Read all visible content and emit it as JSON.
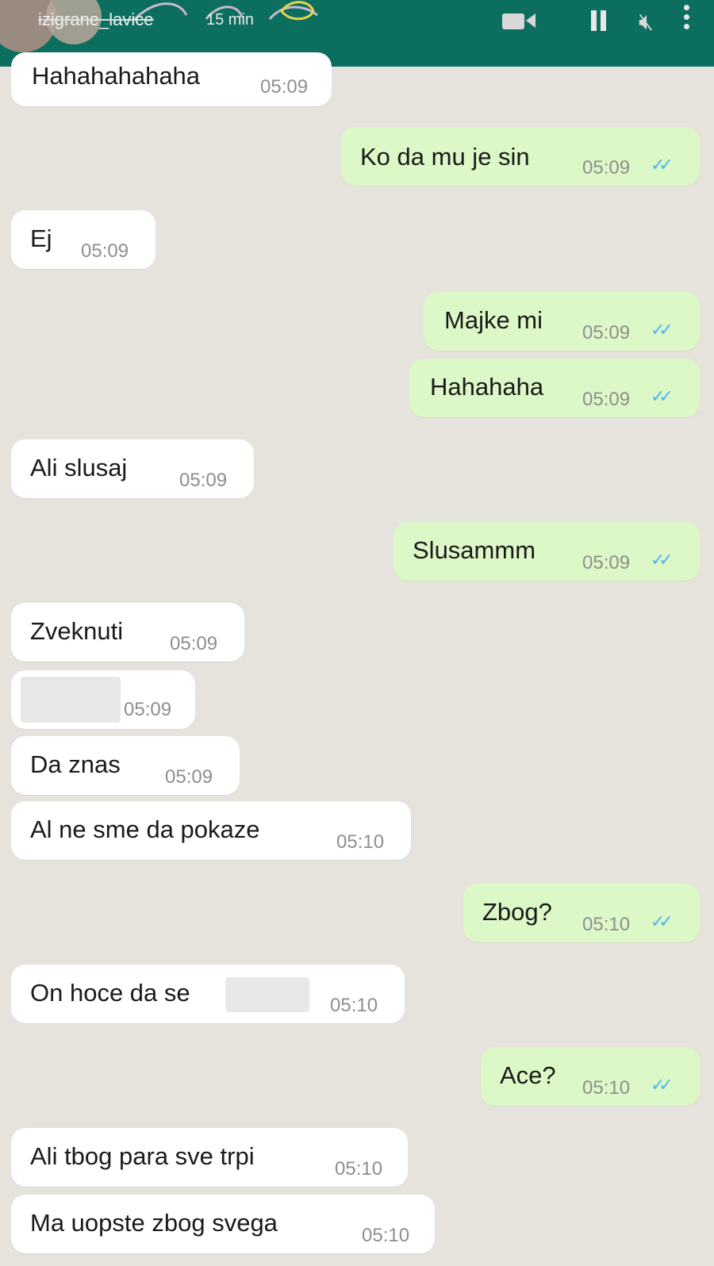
{
  "story": {
    "username": "izigrane_lavice",
    "time_ago": "15 min"
  },
  "icons": [
    "video-camera-icon",
    "pause-icon",
    "mute-icon",
    "more-options-icon"
  ],
  "colors": {
    "header": "#0b6e5f",
    "incoming_bubble": "#ffffff",
    "outgoing_bubble": "#dcf8c6",
    "read_ticks": "#4fb6ec"
  },
  "messages": [
    {
      "dir": "in",
      "text": "Hahahahahaha",
      "time": "05:09"
    },
    {
      "dir": "out",
      "text": "Ko da mu je sin",
      "time": "05:09",
      "read": true
    },
    {
      "dir": "in",
      "text": "Ej",
      "time": "05:09"
    },
    {
      "dir": "out",
      "text": "Majke mi",
      "time": "05:09",
      "read": true
    },
    {
      "dir": "out",
      "text": "Hahahaha",
      "time": "05:09",
      "read": true
    },
    {
      "dir": "in",
      "text": "Ali slusaj",
      "time": "05:09"
    },
    {
      "dir": "out",
      "text": "Slusammm",
      "time": "05:09",
      "read": true
    },
    {
      "dir": "in",
      "text": "Zveknuti",
      "time": "05:09"
    },
    {
      "dir": "in",
      "text": "",
      "time": "05:09",
      "redacted": true
    },
    {
      "dir": "in",
      "text": "Da znas",
      "time": "05:09"
    },
    {
      "dir": "in",
      "text": "Al ne sme da pokaze",
      "time": "05:10"
    },
    {
      "dir": "out",
      "text": "Zbog?",
      "time": "05:10",
      "read": true
    },
    {
      "dir": "in",
      "text": "On hoce da se",
      "time": "05:10",
      "redacted_tail": true
    },
    {
      "dir": "out",
      "text": "Ace?",
      "time": "05:10",
      "read": true
    },
    {
      "dir": "in",
      "text": "Ali tbog para sve trpi",
      "time": "05:10"
    },
    {
      "dir": "in",
      "text": "Ma uopste zbog svega",
      "time": "05:10"
    }
  ]
}
